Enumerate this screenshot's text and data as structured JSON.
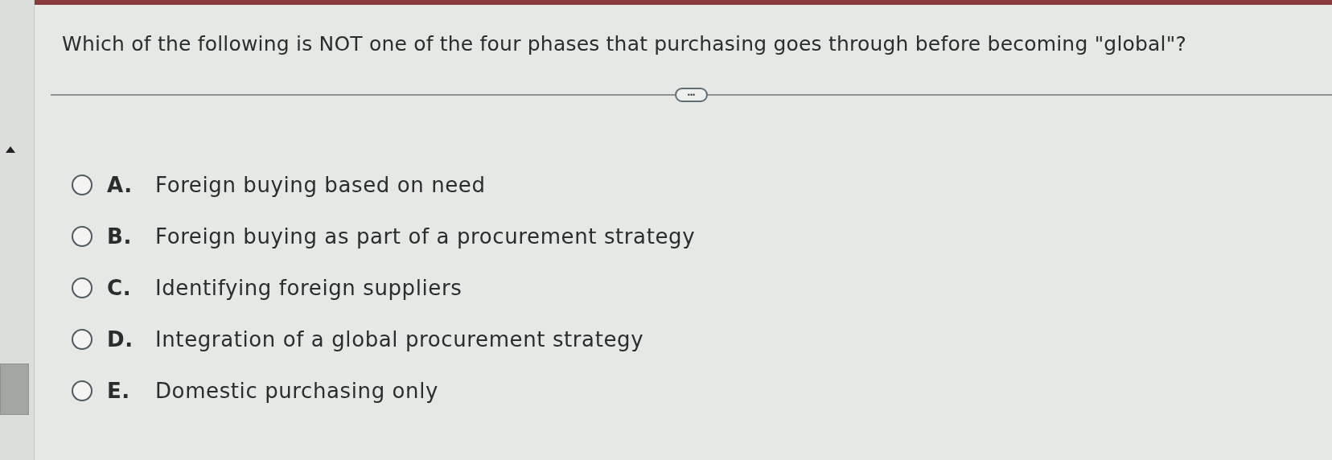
{
  "question": "Which of the following is NOT one of the four phases that purchasing goes through before becoming \"global\"?",
  "expand_button": "•••",
  "options": [
    {
      "letter": "A.",
      "text": "Foreign buying based on need",
      "selected": false
    },
    {
      "letter": "B.",
      "text": "Foreign buying as part of a procurement strategy",
      "selected": false
    },
    {
      "letter": "C.",
      "text": "Identifying foreign suppliers",
      "selected": false
    },
    {
      "letter": "D.",
      "text": "Integration of a global procurement strategy",
      "selected": false
    },
    {
      "letter": "E.",
      "text": "Domestic purchasing only",
      "selected": false
    }
  ]
}
